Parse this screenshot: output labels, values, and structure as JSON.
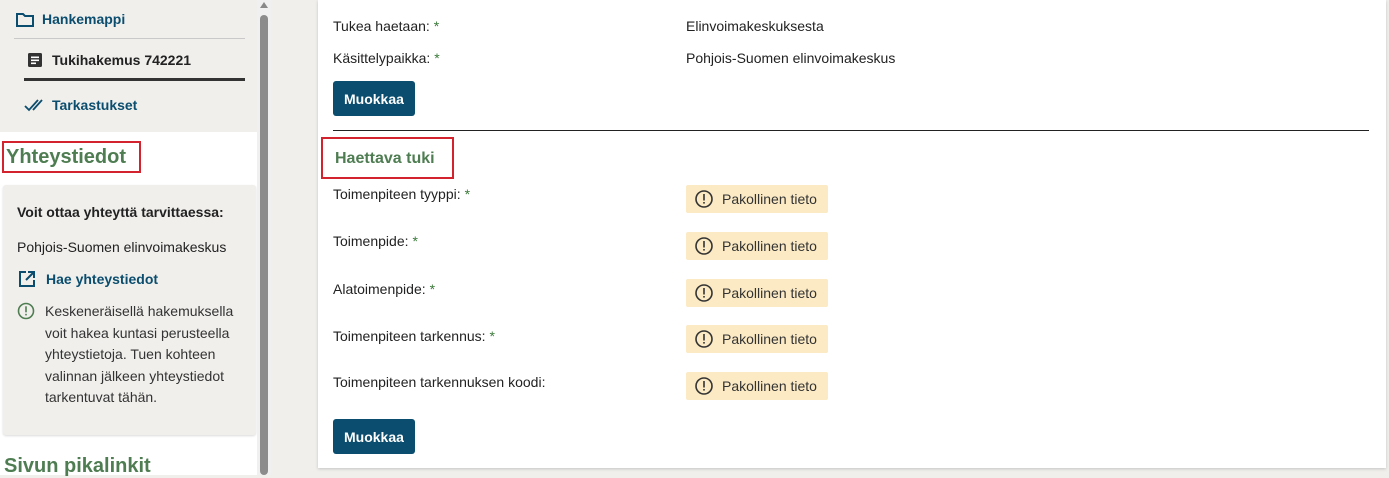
{
  "sidebar": {
    "nav": {
      "hankemappi": "Hankemappi",
      "tukihakemus": "Tukihakemus 742221",
      "tarkastukset": "Tarkastukset"
    },
    "contact_title": "Yhteystiedot",
    "contact_box": {
      "heading": "Voit ottaa yhteyttä tarvittaessa:",
      "organization": "Pohjois-Suomen elinvoimakeskus",
      "link": "Hae yhteystiedot",
      "note": "Keskeneräisellä hakemuksella voit hakea kuntasi perusteella yhteystietoja. Tuen kohteen valinnan jälkeen yhteystiedot tarkentuvat tähän."
    },
    "quicklinks_title": "Sivun pikalinkit"
  },
  "main": {
    "fields_top": [
      {
        "label": "Tukea haetaan:",
        "required": "*",
        "value": "Elinvoimakeskuksesta"
      },
      {
        "label": "Käsittelypaikka:",
        "required": "*",
        "value": "Pohjois-Suomen elinvoimakeskus"
      }
    ],
    "edit_button": "Muokkaa",
    "section_title": "Haettava tuki",
    "fields": [
      {
        "label": "Toimenpiteen tyyppi:",
        "required": "*",
        "status": "Pakollinen tieto"
      },
      {
        "label": "Toimenpide:",
        "required": "*",
        "status": "Pakollinen tieto"
      },
      {
        "label": "Alatoimenpide:",
        "required": "*",
        "status": "Pakollinen tieto"
      },
      {
        "label": "Toimenpiteen tarkennus:",
        "required": "*",
        "status": "Pakollinen tieto"
      },
      {
        "label": "Toimenpiteen tarkennuksen koodi:",
        "required": "",
        "status": "Pakollinen tieto"
      }
    ],
    "edit_button_2": "Muokkaa"
  },
  "colors": {
    "primary": "#0a4d6e",
    "section_green": "#4f7d52",
    "badge_bg": "#fbeac4",
    "highlight_red": "#d3232f"
  }
}
